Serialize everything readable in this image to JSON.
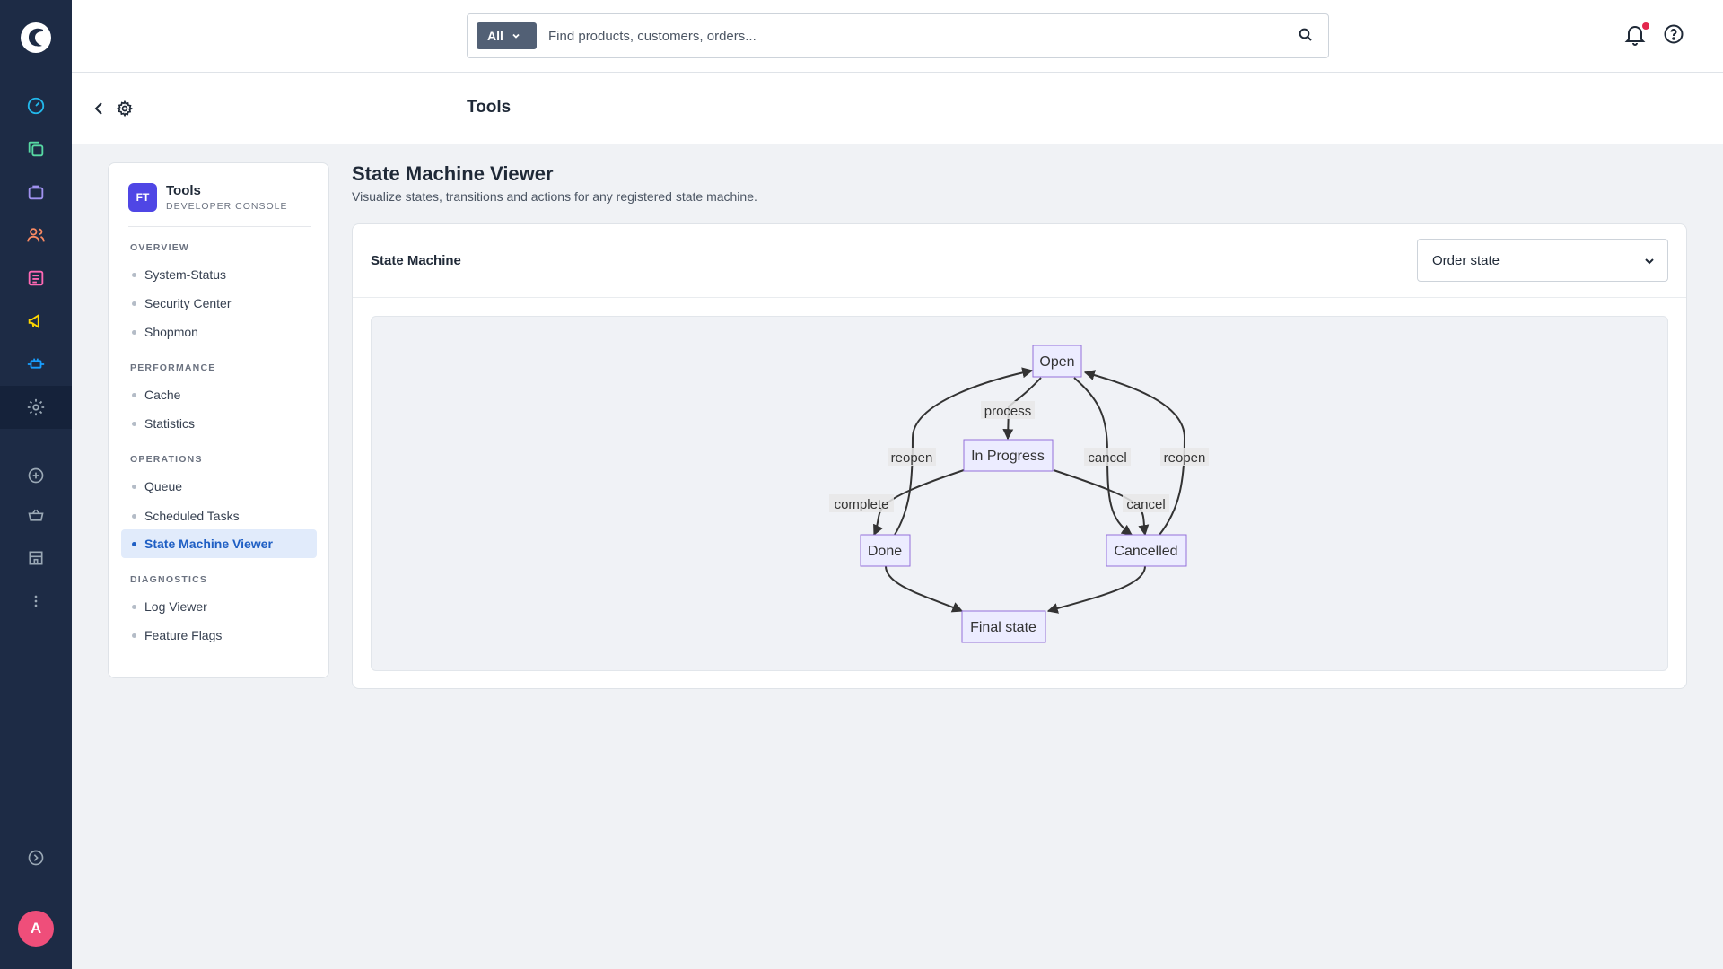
{
  "header": {
    "search_scope": "All",
    "search_placeholder": "Find products, customers, orders..."
  },
  "subheader": {
    "title": "Tools"
  },
  "rail": {
    "icons": [
      "dashboard-icon",
      "catalogues-icon",
      "orders-icon",
      "customers-icon",
      "content-icon",
      "marketing-icon",
      "extensions-icon",
      "settings-icon",
      "add-icon",
      "sales-channel-basket-icon",
      "store-icon",
      "more-icon",
      "expand-icon"
    ],
    "avatar": "A",
    "colors": {
      "dashboard": "#22b7ea",
      "catalogues": "#57d9a3",
      "orders": "#a092f0",
      "customers": "#f88962",
      "content": "#ff68b4",
      "marketing": "#ffd700",
      "extensions": "#189eff",
      "settings": "#9aa8b5"
    }
  },
  "sidenav": {
    "brand_initials": "FT",
    "brand_name": "Tools",
    "brand_sub": "DEVELOPER CONSOLE",
    "sections": [
      {
        "label": "OVERVIEW",
        "items": [
          "System-Status",
          "Security Center",
          "Shopmon"
        ]
      },
      {
        "label": "PERFORMANCE",
        "items": [
          "Cache",
          "Statistics"
        ]
      },
      {
        "label": "OPERATIONS",
        "items": [
          "Queue",
          "Scheduled Tasks",
          "State Machine Viewer"
        ]
      },
      {
        "label": "DIAGNOSTICS",
        "items": [
          "Log Viewer",
          "Feature Flags"
        ]
      }
    ],
    "active_item": "State Machine Viewer"
  },
  "main": {
    "title": "State Machine Viewer",
    "subtitle": "Visualize states, transitions and actions for any registered state machine.",
    "panel_label": "State Machine",
    "selected_machine": "Order state"
  },
  "diagram": {
    "nodes": {
      "open": "Open",
      "in_progress": "In Progress",
      "done": "Done",
      "cancelled": "Cancelled",
      "final": "Final state"
    },
    "edges": {
      "process": "process",
      "reopen_done": "reopen",
      "cancel_open": "cancel",
      "reopen_cancelled": "reopen",
      "complete": "complete",
      "cancel_progress": "cancel"
    },
    "colors": {
      "node_fill": "#ececff",
      "node_stroke": "#9370db",
      "edge": "#333333"
    }
  },
  "colors": {
    "rail_bg": "#1d2b45",
    "accent": "#1f5fc4",
    "avatar": "#ef4e7a",
    "brand": "#4f46e5",
    "notification_dot": "#e3274d"
  }
}
